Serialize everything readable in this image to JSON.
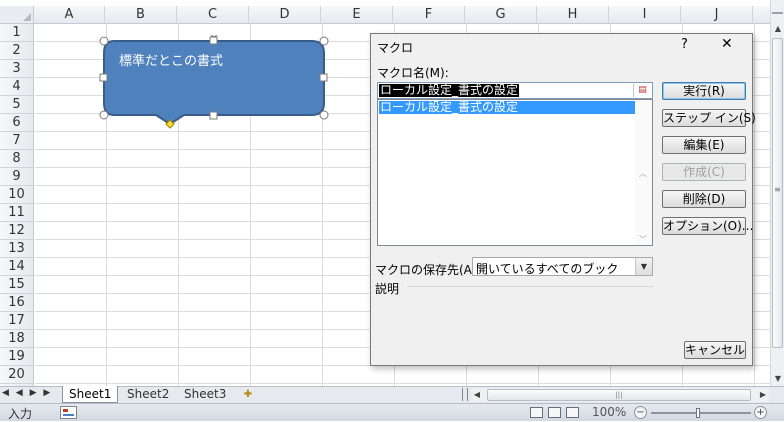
{
  "sheet": {
    "columns": [
      "A",
      "B",
      "C",
      "D",
      "E",
      "F",
      "G",
      "H",
      "I",
      "J"
    ],
    "rows": [
      "1",
      "2",
      "3",
      "4",
      "5",
      "6",
      "7",
      "8",
      "9",
      "10",
      "11",
      "12",
      "13",
      "14",
      "15",
      "16",
      "17",
      "18",
      "19",
      "20"
    ],
    "shape_text": "標準だとこの書式",
    "shape_fill": "#4f81bd",
    "shape_border": "#385d8a"
  },
  "tabs": {
    "nav_glyphs": "◀ ◀ ▶ ▶",
    "sheets": [
      "Sheet1",
      "Sheet2",
      "Sheet3"
    ],
    "active": "Sheet1"
  },
  "status": {
    "mode": "入力",
    "zoom": "100%",
    "zoom_level": 1.0
  },
  "dialog": {
    "title": "マクロ",
    "help": "?",
    "close": "✕",
    "macro_name_label": "マクロ名(M):",
    "macro_name_value": "ローカル設定_書式の設定",
    "macros": [
      "ローカル設定_書式の設定"
    ],
    "store_in_label": "マクロの保存先(A):",
    "store_in_value": "開いているすべてのブック",
    "description_label": "説明",
    "buttons": {
      "run": "実行(R)",
      "step_into": "ステップ イン(S)",
      "edit": "編集(E)",
      "create": "作成(C)",
      "delete": "削除(D)",
      "options": "オプション(O)...",
      "cancel": "キャンセル"
    }
  }
}
